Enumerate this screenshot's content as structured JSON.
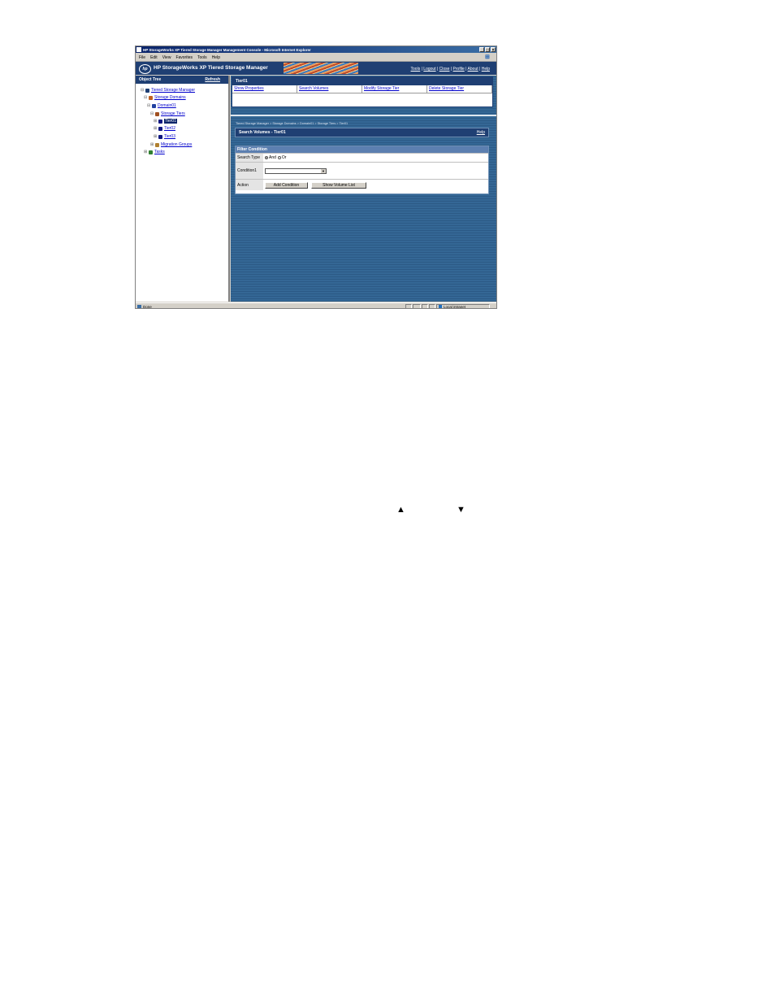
{
  "window": {
    "title": "HP StorageWorks XP Tiered Storage Manager Management Console - Microsoft Internet Explorer",
    "controls": [
      "_",
      "□",
      "×"
    ]
  },
  "menu": [
    "File",
    "Edit",
    "View",
    "Favorites",
    "Tools",
    "Help"
  ],
  "banner": {
    "logo": "hp",
    "product": "HP StorageWorks XP Tiered Storage Manager",
    "links": [
      "Tools",
      "Logout",
      "Close",
      "Profile",
      "About",
      "Help"
    ]
  },
  "object_tree": {
    "header": "Object Tree",
    "refresh": "Refresh",
    "nodes": [
      {
        "label": "Tiered Storage Manager",
        "icon": "app-icon"
      },
      {
        "label": "Storage Domains",
        "icon": "domains-icon"
      },
      {
        "label": "Domain01",
        "icon": "domain-icon"
      },
      {
        "label": "Storage Tiers",
        "icon": "tiers-icon"
      },
      {
        "label": "Tier01",
        "icon": "tier-icon",
        "selected": true
      },
      {
        "label": "Tier02",
        "icon": "tier-icon"
      },
      {
        "label": "Tier03",
        "icon": "tier-icon"
      },
      {
        "label": "Migration Groups",
        "icon": "migration-icon"
      },
      {
        "label": "Tasks",
        "icon": "tasks-icon"
      }
    ]
  },
  "tier_panel": {
    "title": "Tier01",
    "tabs": [
      "Show Properties",
      "Search Volumes",
      "Modify Storage Tier",
      "Delete Storage Tier"
    ]
  },
  "breadcrumb": "Tiered Storage Manager > Storage Domains > Domain01 > Storage Tiers > Tier01",
  "search": {
    "title": "Search Volumes - Tier01",
    "help": "Help",
    "filter_header": "Filter Condition",
    "search_type_label": "Search Type",
    "option_and": "And",
    "option_or": "Or",
    "condition_label": "Condition1",
    "action_label": "Action",
    "add_condition": "Add Condition",
    "show_volume_list": "Show Volume List"
  },
  "status": {
    "text": "Done",
    "zone": "Local intranet"
  },
  "page_glyphs": {
    "up": "▲",
    "down": "▼"
  }
}
